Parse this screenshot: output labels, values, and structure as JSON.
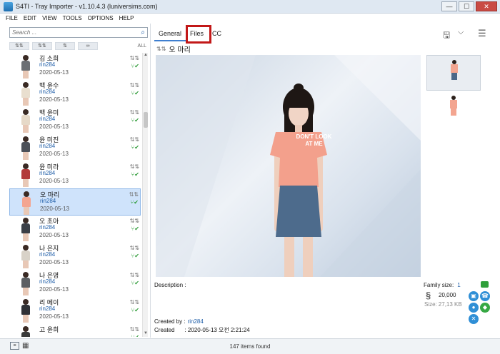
{
  "window": {
    "title": "S4TI - Tray Importer - v1.10.4.3  (luniversims.com)",
    "min": "—",
    "max": "☐",
    "close": "✕"
  },
  "menu": [
    "FILE",
    "EDIT",
    "VIEW",
    "TOOLS",
    "OPTIONS",
    "HELP"
  ],
  "search": {
    "placeholder": "Search ..."
  },
  "sort": {
    "buttons": [
      "⇅⇅",
      "⇅⇅",
      "⇅",
      "∞"
    ],
    "all": "ALL"
  },
  "sims": [
    {
      "name": "김 소희",
      "creator": "rin284",
      "date": "2020-05-13",
      "shirt": "#6b6f74"
    },
    {
      "name": "백 윤수",
      "creator": "rin284",
      "date": "2020-05-13",
      "shirt": "#e9dfcf"
    },
    {
      "name": "백 윤미",
      "creator": "rin284",
      "date": "2020-05-13",
      "shirt": "#e6d9c8"
    },
    {
      "name": "윤 미진",
      "creator": "rin284",
      "date": "2020-05-13",
      "shirt": "#4c5058"
    },
    {
      "name": "윤 미라",
      "creator": "rin284",
      "date": "2020-05-13",
      "shirt": "#b23a3a"
    },
    {
      "name": "오 마리",
      "creator": "rin284",
      "date": "2020-05-13",
      "shirt": "#f3a590",
      "selected": true
    },
    {
      "name": "오 초아",
      "creator": "rin284",
      "date": "2020-05-13",
      "shirt": "#3b3f46"
    },
    {
      "name": "나 은지",
      "creator": "rin284",
      "date": "2020-05-13",
      "shirt": "#d8d2c8"
    },
    {
      "name": "나 은영",
      "creator": "rin284",
      "date": "2020-05-13",
      "shirt": "#5c5f63"
    },
    {
      "name": "리 메이",
      "creator": "rin284",
      "date": "2020-05-13",
      "shirt": "#2f3136"
    },
    {
      "name": "고 윤희",
      "creator": "",
      "date": "",
      "shirt": "#3a3a3a"
    }
  ],
  "tabs": [
    "General",
    "Files",
    "CC"
  ],
  "selected": {
    "name": "오 마리",
    "shirt_text": "DON'T LOOK AT ME",
    "description_label": "Description :",
    "family_size_label": "Family size:",
    "family_size": "1",
    "money": "20,000",
    "size_label": "Size:",
    "size": "27,13 KB",
    "created_by_label": "Created by :",
    "created_by": "rin284",
    "created_label": "Created",
    "created": ":  2020-05-13 오전 2:21:24"
  },
  "status": {
    "count": "147 items found"
  },
  "colors": {
    "accent": "#3f7fd0",
    "highlight": "#c21818",
    "link": "#1f5ea8",
    "check": "#2b9a35"
  }
}
